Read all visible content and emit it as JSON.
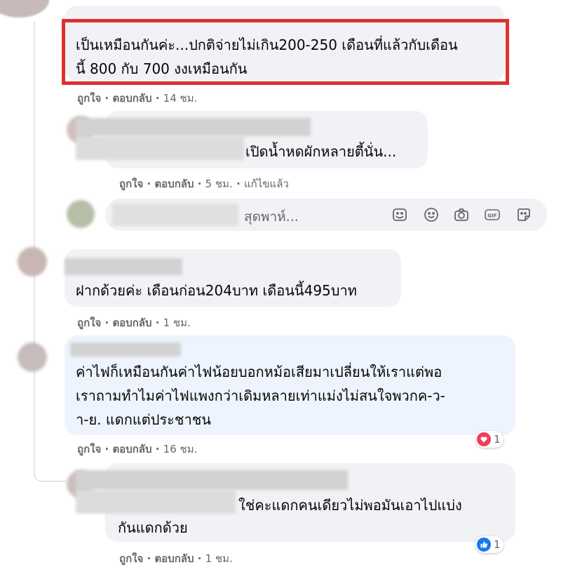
{
  "comments": [
    {
      "lines": [
        "เป็นเหมือนกันค่ะ...ปกติจ่ายไม่เกิน200-250 เดือนที่แล้วกับเดือน",
        "นี้ 800 กับ 700 งงเหมือนกัน"
      ],
      "like": "ถูกใจ",
      "reply": "ตอบกลับ",
      "time": "14 ชม."
    },
    {
      "lines": [
        "เปิดน้ำหดผักหลายตี้นั่น..."
      ],
      "like": "ถูกใจ",
      "reply": "ตอบกลับ",
      "time": "5 ชม.",
      "edited": "แก้ไขแล้ว"
    },
    {
      "lines": [
        "ฝากด้วยค่ะ เดือนก่อน204บาท เดือนนี้495บาท"
      ],
      "like": "ถูกใจ",
      "reply": "ตอบกลับ",
      "time": "1 ชม."
    },
    {
      "lines": [
        "ค่าไฟก็เหมือนกันค่าไฟน้อยบอกหม้อเสียมาเปลี่ยนให้เราแต่พอ",
        "เราถามทำไมค่าไฟแพงกว่าเดิมหลายเท่าแม่งไม่สนใจพวกค-ว-",
        "า-ย. แดกแต่ประชาชน"
      ],
      "like": "ถูกใจ",
      "reply": "ตอบกลับ",
      "time": "16 ชม.",
      "reaction": {
        "type": "love",
        "count": "1"
      }
    },
    {
      "lines": [
        "ใช่คะแดกคนเดียวไม่พอมันเอาไปแบ่ง",
        "กันแดกด้วย"
      ],
      "like": "ถูกใจ",
      "reply": "ตอบกลับ",
      "time": "1 ชม.",
      "reaction": {
        "type": "like",
        "count": "1"
      }
    }
  ],
  "reply_box": {
    "placeholder": "สุดพาห์...",
    "tools": [
      "sticker-icon",
      "emoji-icon",
      "camera-icon",
      "gif-icon",
      "avatar-sticker-icon"
    ]
  },
  "separator": "·",
  "colors": {
    "highlight": "#e0302e",
    "love": "#f33e58",
    "like": "#1877f2",
    "meta": "#65676b"
  }
}
